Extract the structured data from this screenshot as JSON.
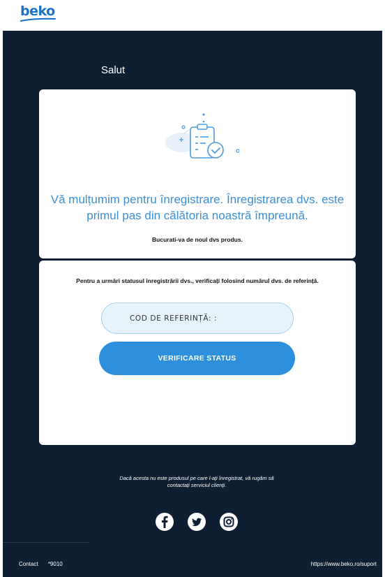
{
  "header": {
    "logo_text": "beko"
  },
  "greeting": "Salut",
  "confirmation_card": {
    "illustration_icon": "clipboard-check-icon",
    "thanks_message": "Vă mulțumim pentru înregistrare. Înregistrarea dvs. este primul pas din călătoria noastră împreună.",
    "enjoy_message": "Bucurati-va de noul dvs produs."
  },
  "status_card": {
    "track_text": "Pentru a urmări statusul înregistrării dvs., verificați folosind numărul dvs. de referință.",
    "reference_field_label": "COD DE REFERINȚĂ: :",
    "verify_button_label": "VERIFICARE STATUS"
  },
  "footer": {
    "notice": "Dacă acesta nu este produsul pe care l-ați înregistrat, vă rugăm să contactați serviciul clienți.",
    "social": [
      "facebook-icon",
      "twitter-icon",
      "instagram-icon"
    ],
    "contact_label": "Contact",
    "contact_number": "*9010",
    "support_url": "https://www.beko.ro/suport"
  },
  "colors": {
    "brand": "#1a73c8",
    "background_dark": "#0f1f33",
    "accent_text": "#3d8fd6",
    "button": "#2e90dc",
    "field_bg": "#e6f3fb"
  }
}
